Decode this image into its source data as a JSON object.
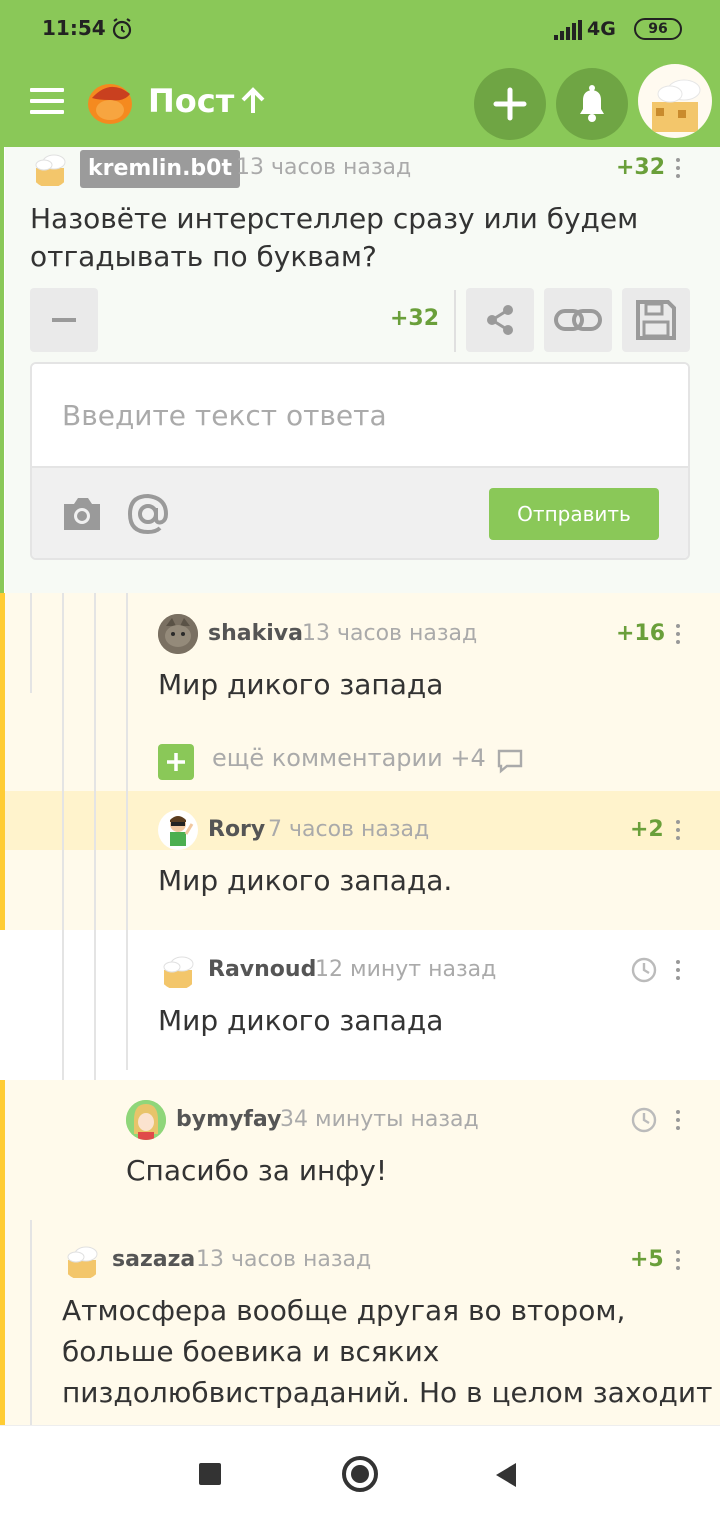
{
  "status_bar": {
    "time": "11:54",
    "network": "4G",
    "battery": "96"
  },
  "header": {
    "title": "Пост"
  },
  "colors": {
    "accent": "#8ac858",
    "rating": "#6a9f3a",
    "thread_highlight": "#ffcc33"
  },
  "post_comment": {
    "author": "kremlin.b0t",
    "time": "13 часов назад",
    "rating": "+32",
    "text": "Назовёте интерстеллер сразу или будем отгадывать по буквам?",
    "inline_rating": "+32"
  },
  "reply": {
    "placeholder": "Введите текст ответа",
    "send_label": "Отправить"
  },
  "comments": [
    {
      "author": "shakiva",
      "time": "13 часов назад",
      "rating": "+16",
      "text": "Мир дикого запада"
    },
    {
      "author": "Rory",
      "time": "7 часов назад",
      "rating": "+2",
      "text": "Мир дикого запада."
    },
    {
      "author": "Ravnoud",
      "time": "12 минут назад",
      "rating": "",
      "text": "Мир дикого запада"
    },
    {
      "author": "bymyfay",
      "time": "34 минуты назад",
      "rating": "",
      "text": "Спасибо за инфу!"
    },
    {
      "author": "sazaza",
      "time": "13 часов назад",
      "rating": "+5",
      "text_lines": [
        "Атмосфера вообще другая во втором,",
        "больше боевика и всяких",
        "пиздолюбвистраданий. Но в целом заходит"
      ]
    }
  ],
  "more_comments": {
    "label": "ещё комментарии +4"
  }
}
